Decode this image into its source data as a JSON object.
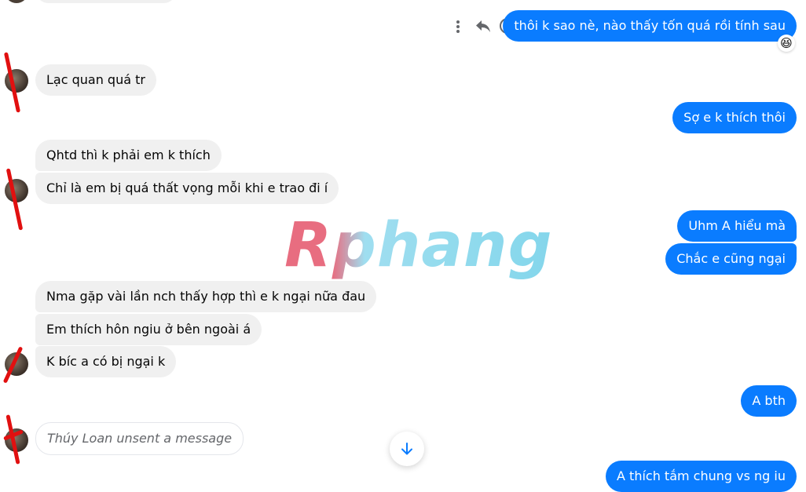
{
  "conversation": {
    "incoming": [
      {
        "text": "Lạc quan quá tr"
      },
      {
        "text": "Qhtd thì k phải em k thích"
      },
      {
        "text": "Chỉ là em bị quá thất vọng mỗi khi e trao đi í"
      },
      {
        "text": "Nma gặp vài lần nch thấy hợp thì e k ngại nữa đau"
      },
      {
        "text": "Em thích hôn ngiu ở bên ngoài á"
      },
      {
        "text": "K bíc a có bị ngại k"
      }
    ],
    "outgoing": [
      {
        "text": "thôi k sao nè, nào thấy tốn quá rồi tính sau"
      },
      {
        "text": "Sợ e k thích thôi"
      },
      {
        "text": "Uhm A hiểu mà"
      },
      {
        "text": "Chắc e cũng ngại"
      },
      {
        "text": "A bth"
      },
      {
        "text": "A thích tắm chung vs ng iu"
      }
    ],
    "unsent_notice": "Thúy Loan unsent a message",
    "reaction_emoji": "😆"
  },
  "watermark": {
    "text": "Rphang"
  },
  "actions": {
    "more_icon": "more-vertical-icon",
    "reply_icon": "reply-icon",
    "react_icon": "smile-icon",
    "scroll_icon": "arrow-down-icon"
  },
  "colors": {
    "outgoing_bubble": "#0a7cff",
    "incoming_bubble": "#f0f0f0",
    "annotation_red": "#e11010"
  }
}
